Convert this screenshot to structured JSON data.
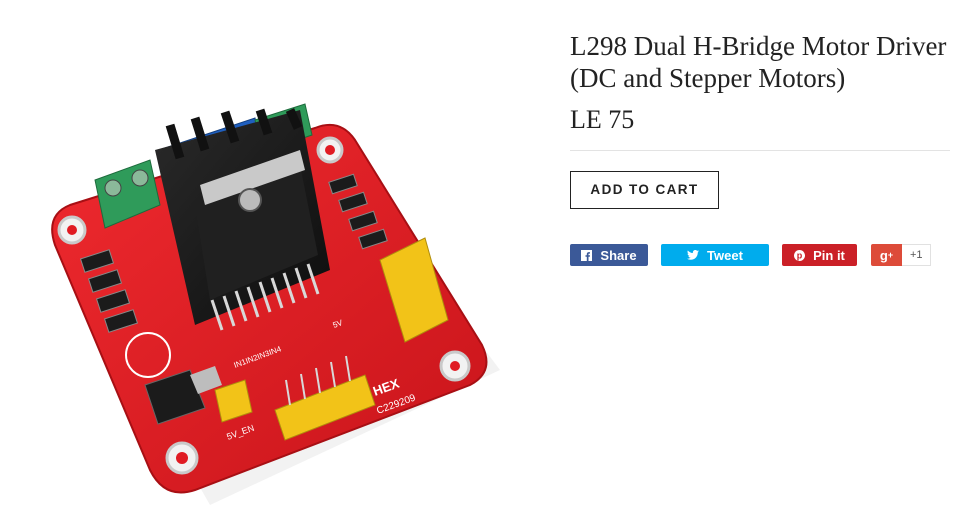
{
  "product": {
    "title": "L298 Dual H-Bridge Motor Driver (DC and Stepper Motors)",
    "price": "LE 75",
    "add_to_cart_label": "ADD TO CART"
  },
  "share": {
    "facebook_label": "Share",
    "twitter_label": "Tweet",
    "pinterest_label": "Pin it",
    "google_plus_count": "+1"
  },
  "image_labels": {
    "brand": "HEX",
    "code": "C229209",
    "jumper": "5V_EN",
    "inputs_top": "IN1IN2IN3IN4",
    "five_v": "5V"
  },
  "colors": {
    "facebook": "#3b5998",
    "twitter": "#00aced",
    "pinterest": "#cb2027",
    "google_plus": "#dd4b39",
    "pcb": "#e01b23"
  }
}
